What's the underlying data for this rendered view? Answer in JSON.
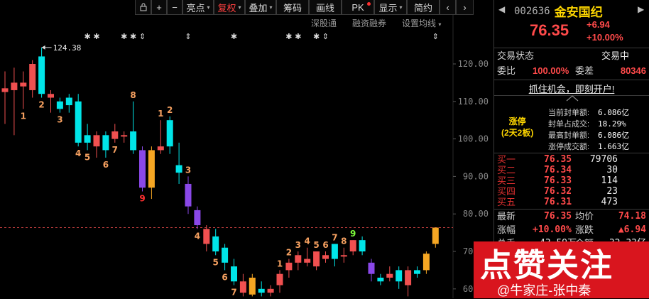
{
  "toolbar": {
    "icons": [
      "lock-icon",
      "plus-icon",
      "minus-icon"
    ],
    "buttons": [
      {
        "label": "亮点",
        "has_dropdown": true
      },
      {
        "label": "复权",
        "has_dropdown": true,
        "active": true
      },
      {
        "label": "叠加",
        "has_dropdown": true
      },
      {
        "label": "筹码"
      },
      {
        "label": "画线"
      },
      {
        "label": "PK",
        "badge": true
      },
      {
        "label": "显示",
        "has_dropdown": true
      },
      {
        "label": "简约"
      }
    ],
    "nav_icons": [
      "chevron-left-icon",
      "chevron-right-icon"
    ]
  },
  "subtools": [
    "深股通",
    "融资融券",
    "设置均线"
  ],
  "chart_data": {
    "type": "candlestick",
    "y_ticks": [
      "120.00",
      "110.00",
      "100.00",
      "90.00",
      "80.00",
      "70.00",
      "60.00"
    ],
    "ylim": [
      58,
      128
    ],
    "max_label": "124.38",
    "limit_up_line": 76.35,
    "candles": [
      {
        "o": 112.5,
        "h": 118,
        "l": 104,
        "c": 113.5,
        "color": "red"
      },
      {
        "o": 113,
        "h": 119,
        "l": 101,
        "c": 115,
        "color": "red"
      },
      {
        "o": 114,
        "h": 118,
        "l": 108,
        "c": 115,
        "color": "red"
      },
      {
        "o": 113,
        "h": 121,
        "l": 111,
        "c": 120,
        "color": "red"
      },
      {
        "o": 112,
        "h": 124.38,
        "l": 111,
        "c": 122,
        "color": "cyan"
      },
      {
        "o": 111,
        "h": 113,
        "l": 107,
        "c": 112,
        "color": "red"
      },
      {
        "o": 110,
        "h": 111,
        "l": 107,
        "c": 108,
        "color": "cyan"
      },
      {
        "o": 111,
        "h": 112,
        "l": 107,
        "c": 109,
        "color": "cyan"
      },
      {
        "o": 110,
        "h": 112,
        "l": 98,
        "c": 99,
        "color": "cyan"
      },
      {
        "o": 101,
        "h": 104,
        "l": 97,
        "c": 99,
        "color": "cyan"
      },
      {
        "o": 98,
        "h": 102,
        "l": 95,
        "c": 101,
        "color": "red"
      },
      {
        "o": 101,
        "h": 102,
        "l": 95,
        "c": 97,
        "color": "cyan"
      },
      {
        "o": 100,
        "h": 104,
        "l": 99,
        "c": 102,
        "color": "red"
      },
      {
        "o": 101,
        "h": 102,
        "l": 99,
        "c": 101,
        "color": "red"
      },
      {
        "o": 102,
        "h": 110,
        "l": 96,
        "c": 97,
        "color": "cyan"
      },
      {
        "o": 97,
        "h": 98,
        "l": 86,
        "c": 87,
        "color": "purple"
      },
      {
        "o": 87,
        "h": 98,
        "l": 84,
        "c": 97,
        "color": "orange"
      },
      {
        "o": 98,
        "h": 105,
        "l": 96,
        "c": 97,
        "color": "red"
      },
      {
        "o": 105,
        "h": 106,
        "l": 96,
        "c": 98,
        "color": "cyan"
      },
      {
        "o": 93,
        "h": 99,
        "l": 88,
        "c": 91,
        "color": "cyan"
      },
      {
        "o": 88,
        "h": 90,
        "l": 80,
        "c": 82,
        "color": "purple"
      },
      {
        "o": 81,
        "h": 82,
        "l": 76,
        "c": 77,
        "color": "purple"
      },
      {
        "o": 76,
        "h": 77,
        "l": 70,
        "c": 72,
        "color": "red"
      },
      {
        "o": 74,
        "h": 76,
        "l": 69,
        "c": 70,
        "color": "cyan"
      },
      {
        "o": 71,
        "h": 72,
        "l": 65,
        "c": 67,
        "color": "cyan"
      },
      {
        "o": 66,
        "h": 68,
        "l": 61,
        "c": 62,
        "color": "cyan"
      },
      {
        "o": 62,
        "h": 64,
        "l": 58,
        "c": 59,
        "color": "red"
      },
      {
        "o": 63,
        "h": 64,
        "l": 58,
        "c": 58.5,
        "color": "orange"
      },
      {
        "o": 60,
        "h": 62,
        "l": 58,
        "c": 59,
        "color": "cyan"
      },
      {
        "o": 59,
        "h": 61,
        "l": 58,
        "c": 60,
        "color": "red"
      },
      {
        "o": 61,
        "h": 65,
        "l": 59,
        "c": 64,
        "color": "red"
      },
      {
        "o": 65,
        "h": 68,
        "l": 63,
        "c": 67,
        "color": "red"
      },
      {
        "o": 67,
        "h": 70,
        "l": 65,
        "c": 69,
        "color": "red"
      },
      {
        "o": 68,
        "h": 71,
        "l": 66,
        "c": 67,
        "color": "red"
      },
      {
        "o": 66,
        "h": 70,
        "l": 65,
        "c": 70,
        "color": "red"
      },
      {
        "o": 69,
        "h": 70,
        "l": 67,
        "c": 68,
        "color": "red"
      },
      {
        "o": 68,
        "h": 72,
        "l": 66,
        "c": 72,
        "color": "cyan"
      },
      {
        "o": 69,
        "h": 71,
        "l": 67,
        "c": 69,
        "color": "red"
      },
      {
        "o": 70,
        "h": 73,
        "l": 69,
        "c": 73,
        "color": "red"
      },
      {
        "o": 73,
        "h": 74,
        "l": 69,
        "c": 70,
        "color": "cyan"
      },
      {
        "o": 67,
        "h": 68,
        "l": 62,
        "c": 64,
        "color": "purple"
      },
      {
        "o": 63,
        "h": 64,
        "l": 61,
        "c": 62,
        "color": "cyan"
      },
      {
        "o": 64,
        "h": 66,
        "l": 62,
        "c": 63,
        "color": "red"
      },
      {
        "o": 65,
        "h": 66,
        "l": 60,
        "c": 62,
        "color": "cyan"
      },
      {
        "o": 61,
        "h": 66,
        "l": 58,
        "c": 65,
        "color": "red"
      },
      {
        "o": 65,
        "h": 66,
        "l": 63,
        "c": 64,
        "color": "cyan"
      },
      {
        "o": 65,
        "h": 70,
        "l": 64,
        "c": 69.4,
        "color": "orange"
      },
      {
        "o": 72,
        "h": 76.35,
        "l": 71,
        "c": 76.35,
        "color": "orange"
      }
    ],
    "td_labels": [
      {
        "i": 2,
        "t": "1",
        "color": "orange",
        "pos": "below"
      },
      {
        "i": 4,
        "t": "2",
        "color": "orange",
        "pos": "below"
      },
      {
        "i": 6,
        "t": "3",
        "color": "orange",
        "pos": "below"
      },
      {
        "i": 8,
        "t": "4",
        "color": "orange",
        "pos": "below"
      },
      {
        "i": 9,
        "t": "5",
        "color": "orange",
        "pos": "below"
      },
      {
        "i": 11,
        "t": "6",
        "color": "orange",
        "pos": "below"
      },
      {
        "i": 12,
        "t": "7",
        "color": "orange",
        "pos": "below"
      },
      {
        "i": 14,
        "t": "8",
        "color": "orange",
        "pos": "above"
      },
      {
        "i": 15,
        "t": "9",
        "color": "red",
        "pos": "below"
      },
      {
        "i": 17,
        "t": "1",
        "color": "orange",
        "pos": "above"
      },
      {
        "i": 18,
        "t": "2",
        "color": "orange",
        "pos": "above"
      },
      {
        "i": 20,
        "t": "3",
        "color": "orange",
        "pos": "above"
      },
      {
        "i": 21,
        "t": "4",
        "color": "orange",
        "pos": "below"
      },
      {
        "i": 23,
        "t": "5",
        "color": "orange",
        "pos": "below"
      },
      {
        "i": 24,
        "t": "6",
        "color": "orange",
        "pos": "below"
      },
      {
        "i": 25,
        "t": "7",
        "color": "orange",
        "pos": "below"
      },
      {
        "i": 30,
        "t": "1",
        "color": "orange",
        "pos": "above"
      },
      {
        "i": 31,
        "t": "2",
        "color": "orange",
        "pos": "above"
      },
      {
        "i": 32,
        "t": "3",
        "color": "orange",
        "pos": "above"
      },
      {
        "i": 33,
        "t": "4",
        "color": "orange",
        "pos": "above"
      },
      {
        "i": 34,
        "t": "5",
        "color": "orange",
        "pos": "above"
      },
      {
        "i": 35,
        "t": "6",
        "color": "orange",
        "pos": "above"
      },
      {
        "i": 36,
        "t": "7",
        "color": "orange",
        "pos": "above"
      },
      {
        "i": 37,
        "t": "8",
        "color": "orange",
        "pos": "above"
      },
      {
        "i": 38,
        "t": "9",
        "color": "green",
        "pos": "above"
      }
    ],
    "markers": [
      {
        "i": 9,
        "t": "✱"
      },
      {
        "i": 10,
        "t": "✱"
      },
      {
        "i": 13,
        "t": "✱"
      },
      {
        "i": 14,
        "t": "✱"
      },
      {
        "i": 14,
        "t": "⇕",
        "offset": 1
      },
      {
        "i": 20,
        "t": "⇕"
      },
      {
        "i": 25,
        "t": "✱"
      },
      {
        "i": 31,
        "t": "✱"
      },
      {
        "i": 32,
        "t": "✱"
      },
      {
        "i": 34,
        "t": "✱"
      },
      {
        "i": 35,
        "t": "⇕"
      },
      {
        "i": 47,
        "t": "⇕"
      }
    ],
    "colors": {
      "red": "#f05050",
      "cyan": "#00e5e8",
      "purple": "#8a48e8",
      "orange": "#f5a623",
      "green": "#7cfc3a"
    }
  },
  "panel": {
    "code": "002636",
    "name": "金安国纪",
    "price": "76.35",
    "change": "+6.94",
    "change_pct": "+10.00%",
    "status_label": "交易状态",
    "status_value": "交易中",
    "weibi_label": "委比",
    "weibi_value": "100.00%",
    "weicha_label": "委差",
    "weicha_value": "80346",
    "promo": "抓住机会，即刻开户!",
    "limit_up_title": "涨停",
    "limit_up_sub": "(2天2板)",
    "limit_up_stats": [
      {
        "k": "当前封单额:",
        "v": "6.086亿"
      },
      {
        "k": "封单占成交:",
        "v": "18.29%"
      },
      {
        "k": "最高封单额:",
        "v": "6.086亿"
      },
      {
        "k": "涨停成交额:",
        "v": "1.663亿"
      }
    ],
    "bids": [
      {
        "label": "买一",
        "price": "76.35",
        "vol": "79706"
      },
      {
        "label": "买二",
        "price": "76.34",
        "vol": "30"
      },
      {
        "label": "买三",
        "price": "76.33",
        "vol": "114"
      },
      {
        "label": "买四",
        "price": "76.32",
        "vol": "23"
      },
      {
        "label": "买五",
        "price": "76.31",
        "vol": "473"
      }
    ],
    "latest_label": "最新",
    "latest_value": "76.35",
    "avg_label": "均价",
    "avg_value": "74.18",
    "pct_label": "涨幅",
    "pct_value": "+10.00%",
    "chg_label": "涨跌",
    "chg_value": "▲6.94",
    "total_label": "总手",
    "total_value": "43.59万",
    "amount_label": "金额",
    "amount_value": "32.33亿"
  },
  "watermark": {
    "big": "点赞关注",
    "small": "@牛家庄-张中秦",
    "color": "#d9151e"
  }
}
